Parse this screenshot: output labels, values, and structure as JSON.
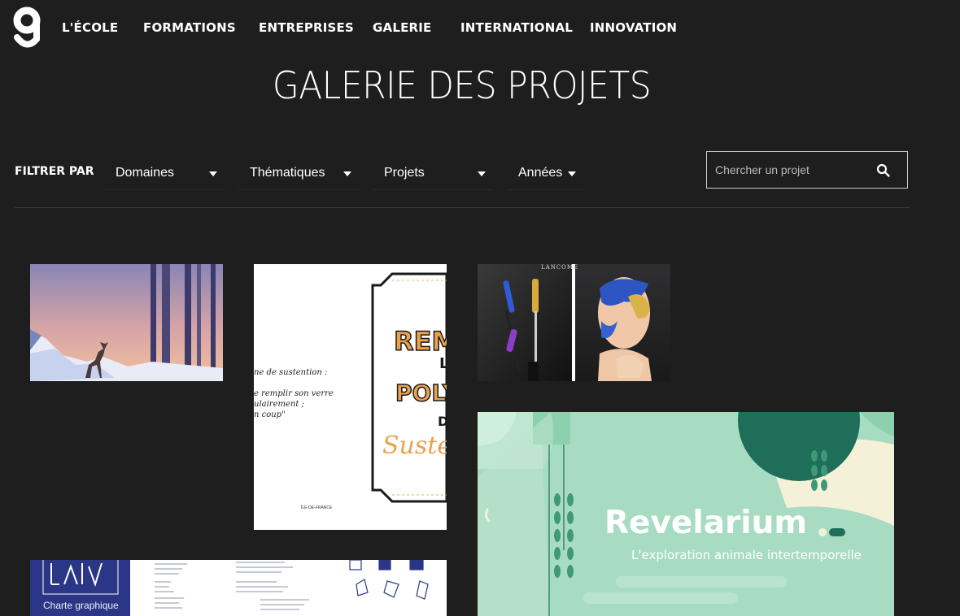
{
  "header": {
    "nav": [
      "L'ÉCOLE",
      "FORMATIONS",
      "ENTREPRISES",
      "GALERIE",
      "INTERNATIONAL",
      "INNOVATION"
    ]
  },
  "page_title": "GALERIE DES PROJETS",
  "filters": {
    "label": "FILTRER PAR",
    "dropdowns": [
      "Domaines",
      "Thématiques",
      "Projets",
      "Années"
    ]
  },
  "search": {
    "placeholder": "Chercher un projet"
  },
  "projects": {
    "poster": {
      "line1": "REM",
      "line2": "L",
      "line3": "POLY",
      "line4": "D",
      "line5": "Susten",
      "side_line1": "ne de sustention :",
      "side_line2": "e remplir son verre",
      "side_line3": "ulairement ;",
      "side_line4": "n coup\"",
      "footer": "ÎLE-DE-FRANCE"
    },
    "lancome": {
      "brand": "LANCÔME"
    },
    "revelarium": {
      "title": "Revelarium",
      "subtitle": "L'exploration animale intertemporelle"
    },
    "charte": {
      "label": "Charte graphique"
    }
  },
  "colors": {
    "background": "#1e1e1e",
    "revelarium_bg": "#a7dcc2",
    "revelarium_dark": "#1f6e5a",
    "poster_orange": "#eaa24c"
  }
}
